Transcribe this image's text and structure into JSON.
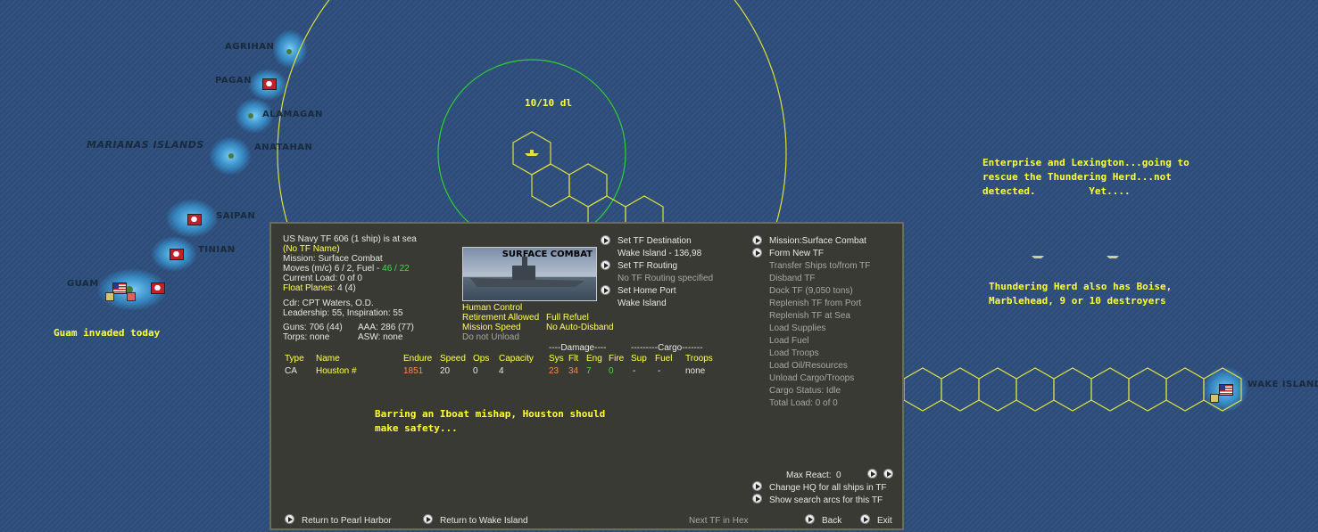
{
  "map": {
    "labels": {
      "agrihan": "AGRIHAN",
      "pagan": "PAGAN",
      "alamagan": "ALAMAGAN",
      "anatahan": "ANATAHAN",
      "marianas": "MARIANAS ISLANDS",
      "saipan": "SAIPAN",
      "tinian": "TINIAN",
      "guam": "GUAM",
      "wake": "WAKE ISLAND"
    },
    "range_label": "10/10 dl",
    "notes": {
      "guam": "Guam invaded today",
      "enterprise": "Enterprise and Lexington...going to\nrescue the Thundering Herd...not\ndetected.         Yet....",
      "herd": "Thundering Herd also has Boise,\nMarblehead, 9 or 10 destroyers",
      "houston": "Barring an Iboat mishap, Houston should\nmake safety..."
    },
    "colors": {
      "ocean": "#2d4c78",
      "hex": "#e0e040",
      "green_ring": "#30d030"
    }
  },
  "panel": {
    "header": "US Navy TF 606 (1 ship) is at sea",
    "tf_name": "(No TF Name)",
    "mission": "Mission: Surface Combat",
    "moves_prefix": "Moves (m/c) 6 / 2, Fuel - ",
    "fuel_value": "46 / 22",
    "current_load": "Current Load: 0 of 0",
    "float_planes_label": "Float Planes:",
    "float_planes_value": "4 (4)",
    "cdr": "Cdr: CPT Waters, O.D.",
    "leadership": "Leadership: 55, Inspiration: 55",
    "guns": "Guns: 706 (44)",
    "aaa": "AAA: 286 (77)",
    "torps": "Torps: none",
    "asw": "ASW: none",
    "image_title": "SURFACE COMBAT",
    "flags": {
      "human_control": "Human Control",
      "retirement": "Retirement Allowed",
      "full_refuel": "Full Refuel",
      "mission_speed": "Mission Speed",
      "no_auto_disband": "No Auto-Disband",
      "do_not_unload": "Do not Unload"
    },
    "actions_mid": {
      "set_dest": "Set TF Destination",
      "dest_value": "Wake Island - 136,98",
      "set_routing": "Set TF Routing",
      "routing_value": "No TF Routing specified",
      "set_home": "Set Home Port",
      "home_value": "Wake Island"
    },
    "actions_right": [
      {
        "label": "Mission:Surface Combat",
        "active": true,
        "button": true
      },
      {
        "label": "Form New TF",
        "active": true,
        "button": true
      },
      {
        "label": "Transfer Ships to/from TF",
        "active": false
      },
      {
        "label": "Disband TF",
        "active": false
      },
      {
        "label": "Dock TF (9,050 tons)",
        "active": false
      },
      {
        "label": "Replenish TF from Port",
        "active": false
      },
      {
        "label": "Replenish TF at Sea",
        "active": false
      },
      {
        "label": "Load Supplies",
        "active": false
      },
      {
        "label": "Load Fuel",
        "active": false
      },
      {
        "label": "Load Troops",
        "active": false
      },
      {
        "label": "Load Oil/Resources",
        "active": false
      },
      {
        "label": "Unload Cargo/Troops",
        "active": false
      },
      {
        "label": "Cargo Status: Idle",
        "active": false
      },
      {
        "label": "Total Load: 0 of 0",
        "active": false
      }
    ],
    "table": {
      "damage_group": "----Damage----",
      "cargo_group": "---------Cargo-------",
      "headers": [
        "Type",
        "Name",
        "Endure",
        "Speed",
        "Ops",
        "Capacity",
        "Sys",
        "Flt",
        "Eng",
        "Fire",
        "Sup",
        "Fuel",
        "Troops"
      ],
      "row": [
        "CA",
        "Houston #",
        "1851",
        "20",
        "0",
        "4",
        "23",
        "34",
        "7",
        "0",
        "-",
        "-",
        "none"
      ]
    },
    "max_react_label": "Max React:",
    "max_react_value": "0",
    "change_hq": "Change HQ for all ships in TF",
    "show_arcs": "Show search arcs for this TF",
    "footer": {
      "return_pearl": "Return to Pearl Harbor",
      "return_wake": "Return to Wake Island",
      "next_tf": "Next TF in Hex",
      "back": "Back",
      "exit": "Exit"
    }
  }
}
